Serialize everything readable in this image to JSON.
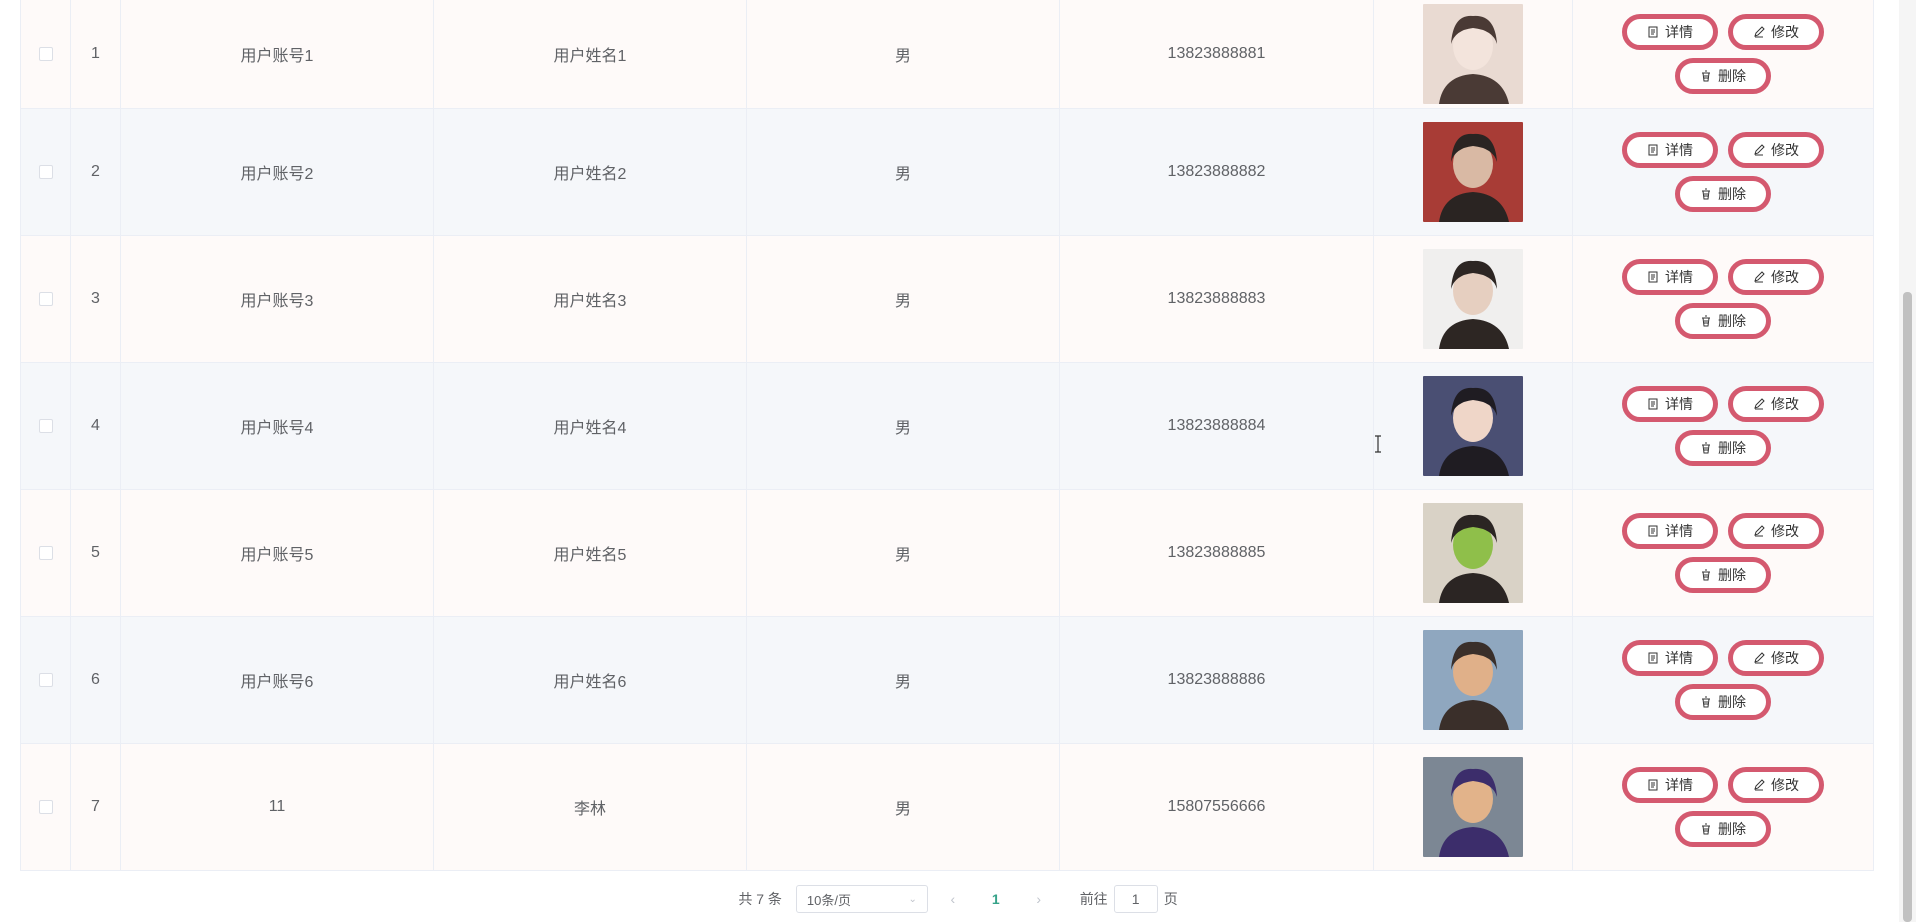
{
  "table": {
    "rows": [
      {
        "index": "1",
        "account": "用户账号1",
        "name": "用户姓名1",
        "sex": "男",
        "phone": "13823888881",
        "photo_icon": "portrait-photo"
      },
      {
        "index": "2",
        "account": "用户账号2",
        "name": "用户姓名2",
        "sex": "男",
        "phone": "13823888882",
        "photo_icon": "portrait-photo"
      },
      {
        "index": "3",
        "account": "用户账号3",
        "name": "用户姓名3",
        "sex": "男",
        "phone": "13823888883",
        "photo_icon": "portrait-photo"
      },
      {
        "index": "4",
        "account": "用户账号4",
        "name": "用户姓名4",
        "sex": "男",
        "phone": "13823888884",
        "photo_icon": "portrait-photo"
      },
      {
        "index": "5",
        "account": "用户账号5",
        "name": "用户姓名5",
        "sex": "男",
        "phone": "13823888885",
        "photo_icon": "portrait-photo"
      },
      {
        "index": "6",
        "account": "用户账号6",
        "name": "用户姓名6",
        "sex": "男",
        "phone": "13823888886",
        "photo_icon": "portrait-photo"
      },
      {
        "index": "7",
        "account": "11",
        "name": "李林",
        "sex": "男",
        "phone": "15807556666",
        "photo_icon": "portrait-photo"
      }
    ],
    "actions": {
      "detail": "详情",
      "edit": "修改",
      "delete": "删除"
    }
  },
  "pagination": {
    "total": "共 7 条",
    "page_size": "10条/页",
    "current_page": "1",
    "goto_prefix": "前往",
    "goto_value": "1",
    "goto_suffix": "页"
  },
  "colors": {
    "button_border": "#d4596f",
    "active_page": "#36a389"
  }
}
